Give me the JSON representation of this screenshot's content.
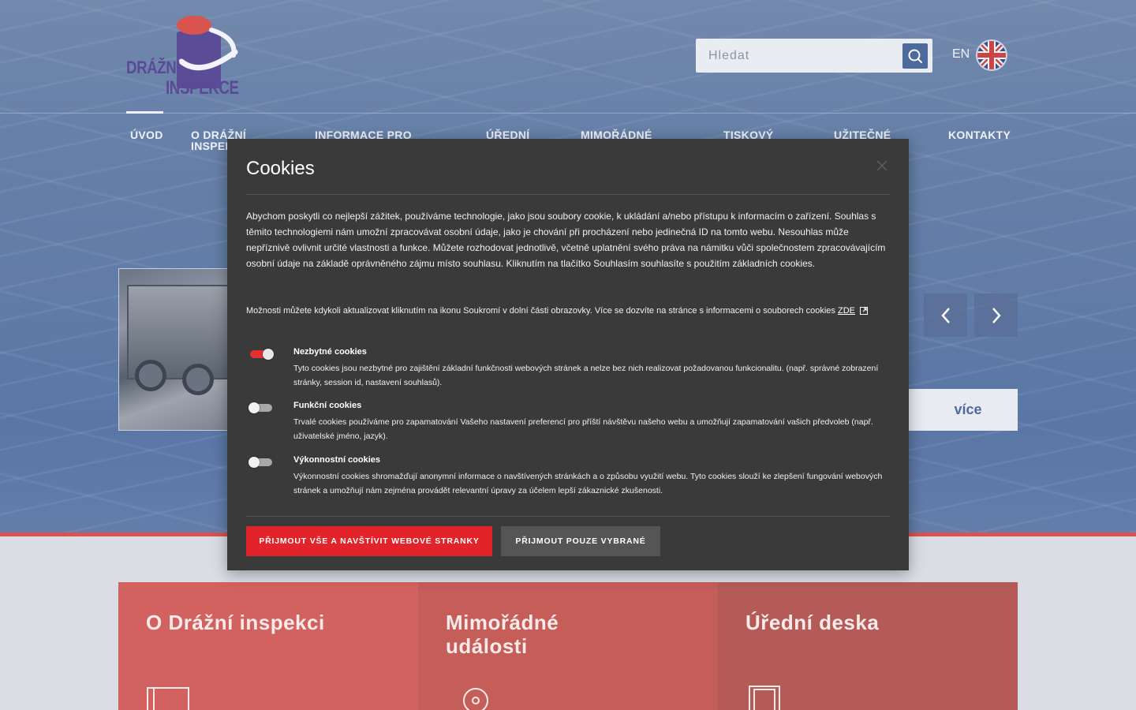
{
  "header": {
    "logo_line1": "DRÁŽNÍ",
    "logo_line2": "INSPEKCE",
    "search_placeholder": "Hledat",
    "lang_label": "EN"
  },
  "nav": {
    "items": [
      {
        "label": "ÚVOD"
      },
      {
        "label": "O DRÁŽNÍ INSPEKCI"
      },
      {
        "label": "INFORMACE PRO"
      },
      {
        "label": "ÚŘEDNÍ"
      },
      {
        "label": "MIMOŘÁDNÉ"
      },
      {
        "label": "TISKOVÝ"
      },
      {
        "label": "UŽITEČNÉ"
      },
      {
        "label": "KONTAKTY"
      }
    ],
    "o_drazni_line1": "O DRÁŽNÍ",
    "o_drazni_line2": "INSPEK"
  },
  "slider": {
    "more_label": "více"
  },
  "tiles": [
    {
      "title_line1": "O Drážní inspekci",
      "title_line2": "",
      "color": "#d2625f"
    },
    {
      "title_line1": "Mimořádné",
      "title_line2": "události",
      "color": "#c55d59"
    },
    {
      "title_line1": "Úřední deska",
      "title_line2": "",
      "color": "#b55b57"
    }
  ],
  "cookies": {
    "title": "Cookies",
    "intro": "Abychom poskytli co nejlepší zážitek, používáme technologie, jako jsou soubory cookie, k ukládání a/nebo přístupu k informacím o zařízení. Souhlas s těmito technologiemi nám umožní zpracovávat osobní údaje, jako je chování při procházení nebo jedinečná ID na tomto webu. Nesouhlas může nepříznivě ovlivnit určité vlastnosti a funkce. Můžete rozhodovat jednotlivě, včetně uplatnění svého práva na námitku vůči společnostem zpracovávajícím osobní údaje na základě oprávněného zájmu místo souhlasu. Kliknutím na tlačítko Souhlasím souhlasíte s použitím základních cookies.",
    "options_text": "Možnosti můžete kdykoli aktualizovat kliknutím na ikonu Soukromí v dolní části obrazovky. Více se dozvíte na stránce s informacemi o souborech cookies",
    "options_link": "ZDE",
    "categories": [
      {
        "title": "Nezbytné cookies",
        "description": "Tyto cookies jsou nezbytné pro zajištění základní funkčnosti webových stránek a nelze bez nich realizovat požadovanou funkcionalitu. (např. správné zobrazení stránky, session id, nastavení souhlasů).",
        "enabled": true
      },
      {
        "title": "Funkční cookies",
        "description": "Trvalé cookies používáme pro zapamatování Vašeho nastavení preferencí pro příští návštěvu našeho webu a umožňují zapamatování vašich předvoleb (např. uživatelské jméno, jazyk).",
        "enabled": false
      },
      {
        "title": "Výkonnostní cookies",
        "description": "Výkonnostní cookies shromažďují anonymní informace o navštívených stránkách a o způsobu využití webu. Tyto cookies slouží ke zlepšení fungování webových stránek a umožňují nám zejména provádět relevantní úpravy za účelem lepší zákaznické zkušenosti.",
        "enabled": false
      }
    ],
    "accept_all_label": "PŘIJMOUT VŠE A NAVŠTÍVIT WEBOVÉ STRANKY",
    "accept_selected_label": "PŘIJMOUT POUZE VYBRANÉ"
  },
  "colors": {
    "accent_red": "#e2232a",
    "dialog_bg": "#3a3a3a",
    "brand_blue": "#4d6a9c"
  }
}
